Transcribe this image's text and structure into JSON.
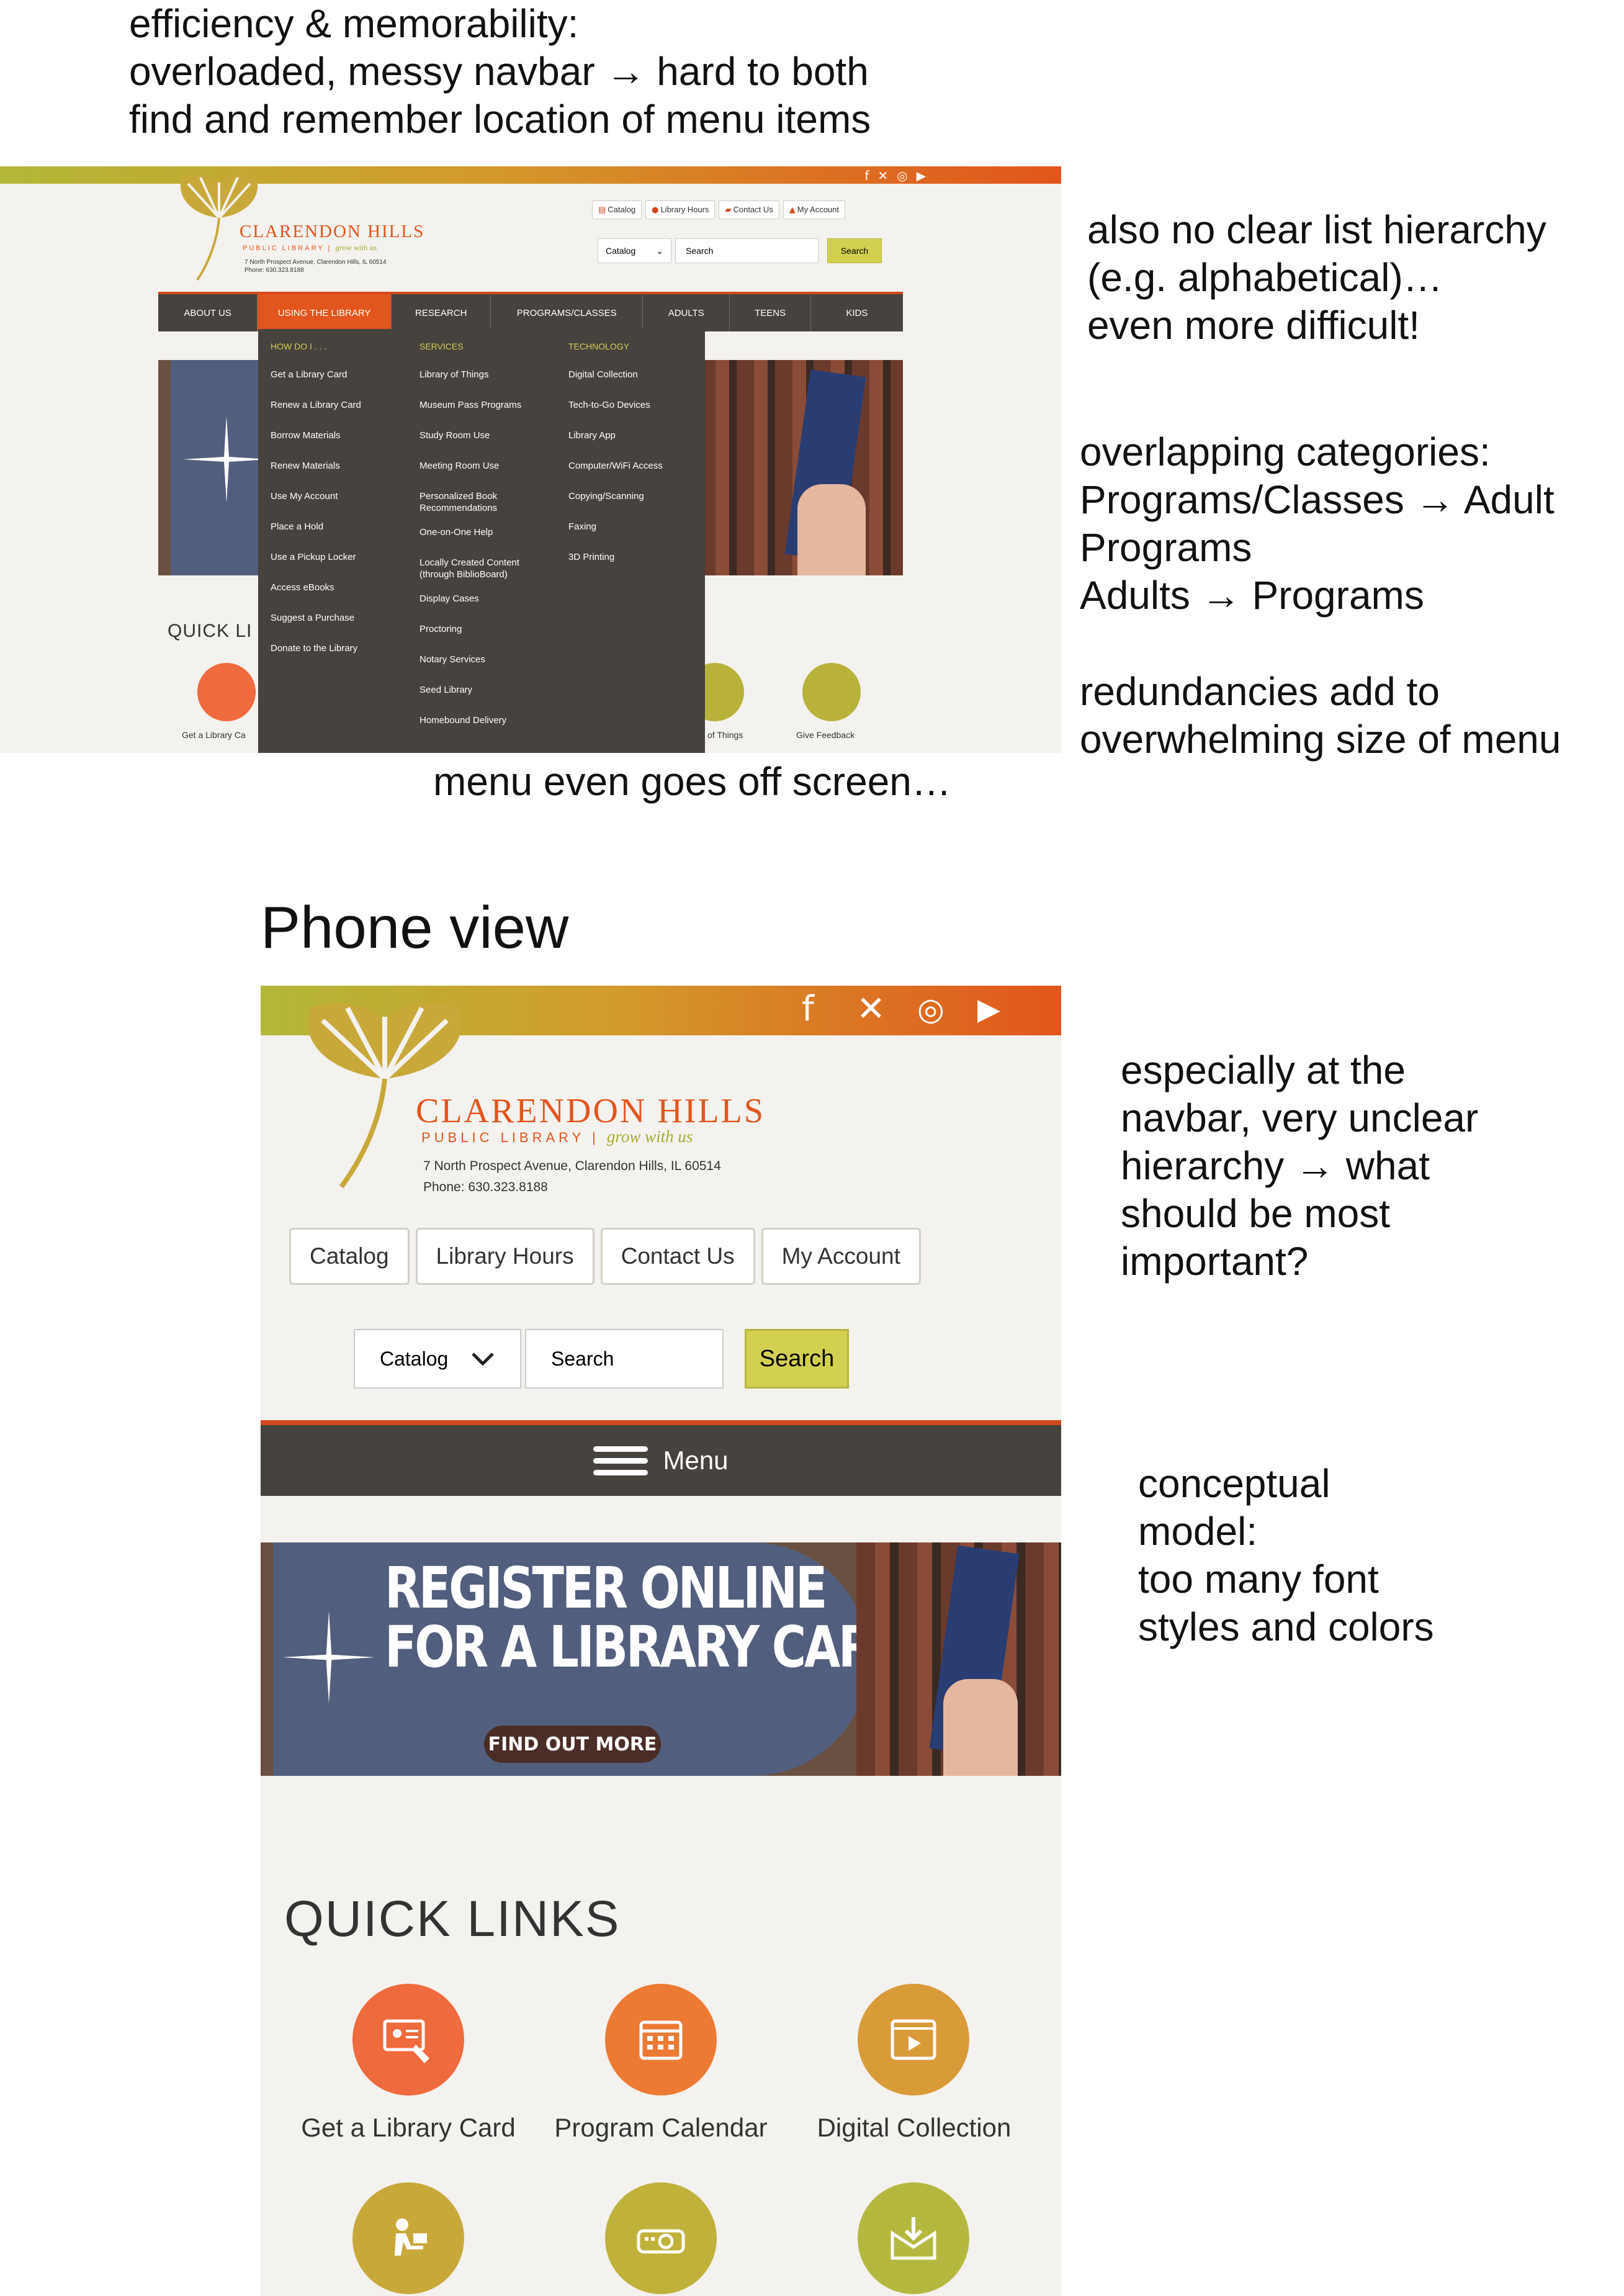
{
  "notes": {
    "efficiency": "efficiency & memorability:\noverloaded, messy navbar → hard to both\nfind and remember location of menu items",
    "hierarchy": "also no clear list hierarchy\n(e.g. alphabetical)…\neven more difficult!",
    "overlap": "overlapping categories:\nPrograms/Classes → Adult\nPrograms\nAdults → Programs",
    "redundancies": "redundancies add to\noverwhelming size of menu",
    "offscreen": "menu even goes off screen…",
    "phone_view": "Phone view",
    "navbar_hierarchy": "especially at the\nnavbar, very unclear\nhierarchy → what\nshould be most\nimportant?",
    "conceptual": "conceptual\nmodel:\ntoo many font\nstyles and colors"
  },
  "colors": {
    "accent_orange": "#e2551c",
    "nav_dark": "#46423d",
    "search_yellow": "#d3d051",
    "hero_blue": "#525e7d",
    "background": "#f4f2ee"
  },
  "site": {
    "brand": "CLARENDON HILLS",
    "brand_sub": "PUBLIC LIBRARY",
    "tagline": "grow with us",
    "address": "7 North Prospect Avenue, Clarendon Hills, IL 60514",
    "phone": "Phone: 630.323.8188",
    "socials": [
      "facebook-icon",
      "x-icon",
      "instagram-icon",
      "youtube-icon"
    ]
  },
  "desktop": {
    "utility_links": [
      "Catalog",
      "Library Hours",
      "Contact Us",
      "My Account"
    ],
    "search": {
      "select_value": "Catalog",
      "placeholder": "Search",
      "button": "Search"
    },
    "nav": [
      "ABOUT US",
      "USING THE LIBRARY",
      "RESEARCH",
      "PROGRAMS/CLASSES",
      "ADULTS",
      "TEENS",
      "KIDS"
    ],
    "nav_active": "USING THE LIBRARY",
    "mega_menu": {
      "col1": {
        "heading": "HOW DO I . . .",
        "items": [
          "Get a Library Card",
          "Renew a Library Card",
          "Borrow Materials",
          "Renew Materials",
          "Use My Account",
          "Place a Hold",
          "Use a Pickup Locker",
          "Access eBooks",
          "Suggest a Purchase",
          "Donate to the Library"
        ]
      },
      "col2": {
        "heading": "SERVICES",
        "items": [
          "Library of Things",
          "Museum Pass Programs",
          "Study Room Use",
          "Meeting Room Use",
          "Personalized Book Recommendations",
          "One-on-One Help",
          "Locally Created Content (through BiblioBoard)",
          "Display Cases",
          "Proctoring",
          "Notary Services",
          "Seed Library",
          "Homebound Delivery"
        ]
      },
      "col3": {
        "heading": "TECHNOLOGY",
        "items": [
          "Digital Collection",
          "Tech-to-Go Devices",
          "Library App",
          "Computer/WiFi Access",
          "Copying/Scanning",
          "Faxing",
          "3D Printing"
        ]
      }
    },
    "quick_links_title": "QUICK LI",
    "quick_visible": [
      "Get a Library Ca",
      "of Things",
      "Give Feedback"
    ]
  },
  "phone": {
    "utility_links": [
      "Catalog",
      "Library Hours",
      "Contact Us",
      "My Account"
    ],
    "search": {
      "select_value": "Catalog",
      "placeholder": "Search",
      "button": "Search"
    },
    "menu_label": "Menu",
    "hero": {
      "line1": "REGISTER ONLINE",
      "line2": "FOR A LIBRARY CARD",
      "cta": "FIND OUT MORE"
    },
    "quick_links_title": "QUICK LINKS",
    "quick_links": [
      "Get a Library Card",
      "Program Calendar",
      "Digital Collection"
    ]
  }
}
